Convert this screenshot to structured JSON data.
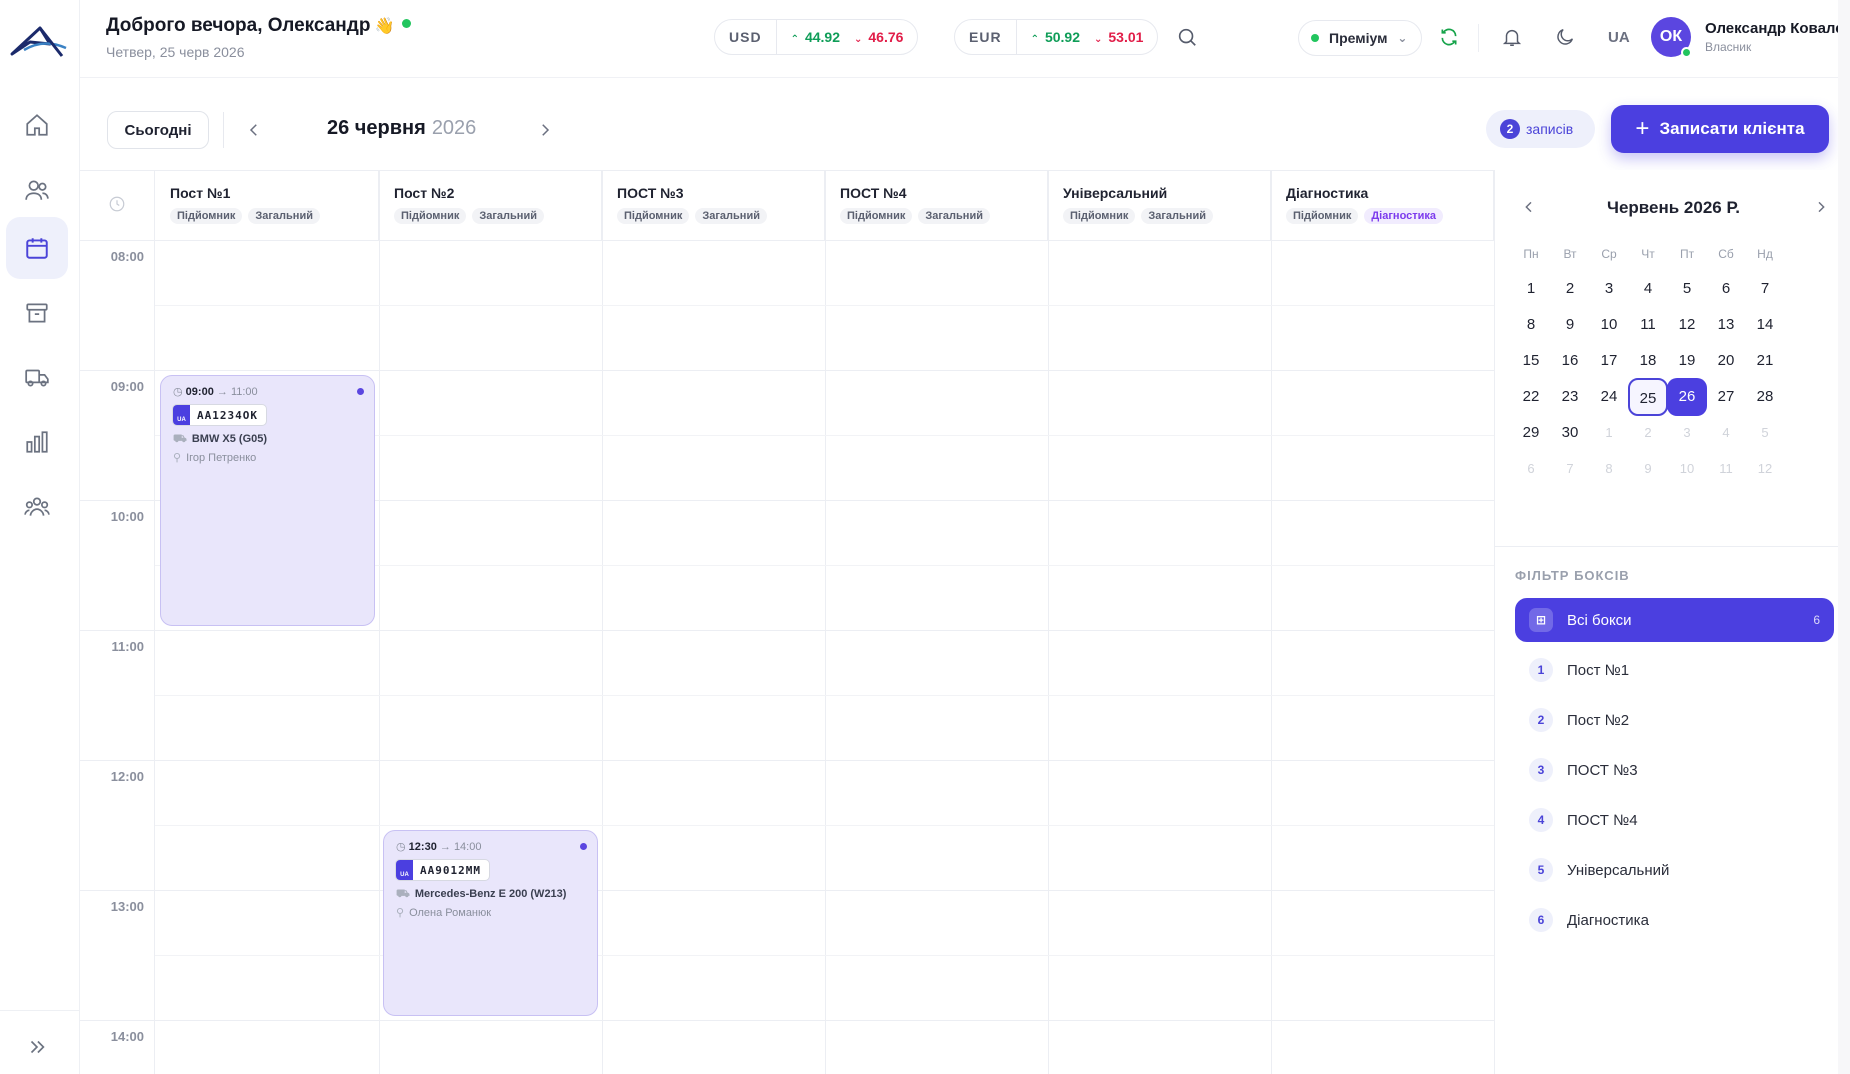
{
  "header": {
    "greeting": "Доброго вечора, Олександр",
    "wave": "👋",
    "date": "Четвер, 25 черв 2026",
    "currencies": [
      {
        "code": "USD",
        "buy": "44.92",
        "sell": "46.76"
      },
      {
        "code": "EUR",
        "buy": "50.92",
        "sell": "53.01"
      }
    ],
    "plan": "Преміум",
    "language": "UA",
    "user": {
      "initials": "ОК",
      "name": "Олександр Коваленко",
      "role": "Власник"
    }
  },
  "toolbar": {
    "today_label": "Сьогодні",
    "current_date": "26 червня",
    "current_year": "2026",
    "appointments_count": "2",
    "appointments_label": "записів",
    "add_button": "Записати клієнта"
  },
  "columns": [
    {
      "name": "Пост №1",
      "tags": [
        "Підйомник",
        "Загальний"
      ]
    },
    {
      "name": "Пост №2",
      "tags": [
        "Підйомник",
        "Загальний"
      ]
    },
    {
      "name": "ПОСТ №3",
      "tags": [
        "Підйомник",
        "Загальний"
      ]
    },
    {
      "name": "ПОСТ №4",
      "tags": [
        "Підйомник",
        "Загальний"
      ]
    },
    {
      "name": "Універсальний",
      "tags": [
        "Підйомник",
        "Загальний"
      ]
    },
    {
      "name": "Діагностика",
      "tags": [
        "Підйомник",
        "Діагностика"
      ]
    }
  ],
  "times": [
    "08:00",
    "09:00",
    "10:00",
    "11:00",
    "12:00",
    "13:00",
    "14:00"
  ],
  "events": [
    {
      "start": "09:00",
      "arrow": "→",
      "end": "11:00",
      "plate_flag": "UA",
      "plate": "AA1234OK",
      "car": "BMW X5 (G05)",
      "client": "Ігор Петренко"
    },
    {
      "start": "12:30",
      "arrow": "→",
      "end": "14:00",
      "plate_flag": "UA",
      "plate": "AA9012MM",
      "car": "Mercedes-Benz E 200 (W213)",
      "client": "Олена Романюк"
    }
  ],
  "mini_calendar": {
    "month": "Червень 2026 Р.",
    "weekdays": [
      "Пн",
      "Вт",
      "Ср",
      "Чт",
      "Пт",
      "Сб",
      "Нд"
    ],
    "weeks": [
      [
        "1",
        "2",
        "3",
        "4",
        "5",
        "6",
        "7"
      ],
      [
        "8",
        "9",
        "10",
        "11",
        "12",
        "13",
        "14"
      ],
      [
        "15",
        "16",
        "17",
        "18",
        "19",
        "20",
        "21"
      ],
      [
        "22",
        "23",
        "24",
        "25",
        "26",
        "27",
        "28"
      ],
      [
        "29",
        "30",
        "1",
        "2",
        "3",
        "4",
        "5"
      ],
      [
        "6",
        "7",
        "8",
        "9",
        "10",
        "11",
        "12"
      ]
    ],
    "today": "25",
    "selected": "26"
  },
  "filter": {
    "title": "ФІЛЬТР БОКСІВ",
    "all_label": "Всі бокси",
    "all_count": "6",
    "items": [
      {
        "num": "1",
        "label": "Пост №1"
      },
      {
        "num": "2",
        "label": "Пост №2"
      },
      {
        "num": "3",
        "label": "ПОСТ №3"
      },
      {
        "num": "4",
        "label": "ПОСТ №4"
      },
      {
        "num": "5",
        "label": "Універсальний"
      },
      {
        "num": "6",
        "label": "Діагностика"
      }
    ]
  },
  "colors": {
    "accent": "#4b3fe0",
    "up": "#0f9d58",
    "down": "#e11d48",
    "event_bg": "#e9e6fb"
  }
}
